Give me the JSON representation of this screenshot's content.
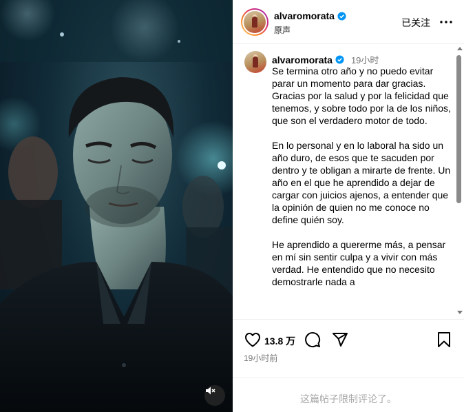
{
  "header": {
    "username": "alvaromorata",
    "audio_label": "原声",
    "follow_label": "已关注",
    "more_icon": "more-horizontal-icon"
  },
  "caption": {
    "username": "alvaromorata",
    "time": "19小时",
    "text": "Se termina otro año y no puedo evitar parar un momento para dar gracias.\nGracias por la salud y por la felicidad que tenemos, y sobre todo por la de los niños, que son el verdadero motor de todo.\n\nEn lo personal y en lo laboral ha sido un año duro, de esos que te sacuden por dentro y te obligan a mirarte de frente. Un año en el que he aprendido a dejar de cargar con juicios ajenos, a entender que la opinión de quien no me conoce no define quién soy.\n\nHe aprendido a quererme más, a pensar en mí sin sentir culpa y a vivir con más verdad. He entendido que no necesito demostrarle nada a"
  },
  "actions": {
    "like_count": "13.8 万",
    "post_time": "19小时前",
    "icons": [
      "heart-icon",
      "comment-icon",
      "share-icon",
      "bookmark-icon"
    ]
  },
  "comments": {
    "disabled_text": "这篇帖子限制评论了。"
  },
  "media": {
    "mute_icon": "speaker-muted-icon"
  },
  "colors": {
    "verified_blue": "#0095f6",
    "secondary_text": "#737373",
    "disabled_text": "#a8a8a8",
    "divider": "#efefef"
  }
}
